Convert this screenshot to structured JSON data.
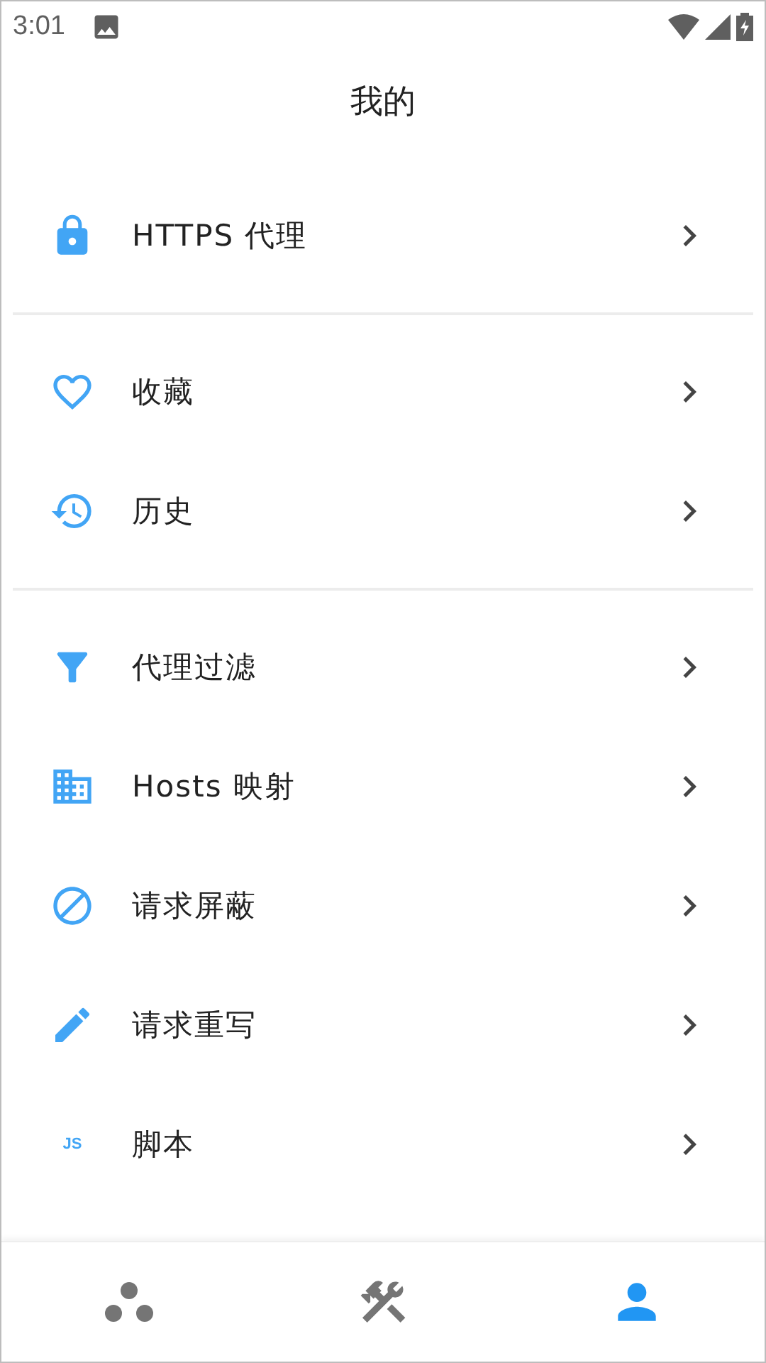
{
  "status_bar": {
    "time": "3:01"
  },
  "title": "我的",
  "sections": [
    {
      "items": [
        {
          "kind": "glyph",
          "title": "HTTPS 代理"
        }
      ]
    },
    {
      "items": [
        {
          "kind": "glyph",
          "title": "收藏"
        },
        {
          "kind": "glyph",
          "title": "历史"
        }
      ]
    },
    {
      "items": [
        {
          "kind": "glyph",
          "title": "代理过滤"
        },
        {
          "kind": "glyph",
          "title": "Hosts 映射"
        },
        {
          "kind": "glyph",
          "title": "请求屏蔽"
        },
        {
          "kind": "glyph",
          "title": "请求重写"
        },
        {
          "kind": "text",
          "icon_text": "JS",
          "title": "脚本"
        }
      ]
    }
  ],
  "bottom_nav": [
    {
      "selected": false
    },
    {
      "selected": false
    },
    {
      "selected": true
    }
  ]
}
